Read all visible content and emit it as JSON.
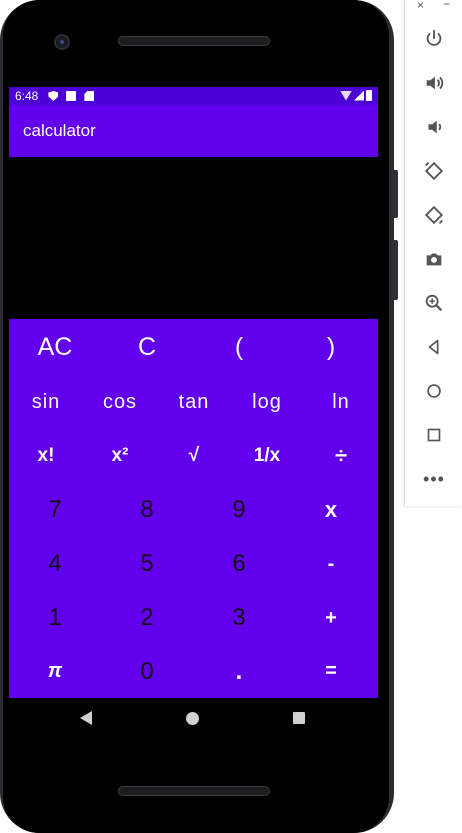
{
  "status_bar": {
    "time": "6:48"
  },
  "app": {
    "title": "calculator"
  },
  "keypad": {
    "row1": [
      "AC",
      "C",
      "(",
      ")"
    ],
    "row2": [
      "sin",
      "cos",
      "tan",
      "log",
      "ln"
    ],
    "row3": [
      "x!",
      "x²",
      "√",
      "1/x",
      "÷"
    ],
    "row4": [
      "7",
      "8",
      "9",
      "x"
    ],
    "row5": [
      "4",
      "5",
      "6",
      "-"
    ],
    "row6": [
      "1",
      "2",
      "3",
      "+"
    ],
    "row7": [
      "π",
      "0",
      ".",
      "="
    ]
  },
  "emulator": {
    "close": "×",
    "minimize": "−",
    "more": "•••",
    "icons": [
      "power-icon",
      "volume-up-icon",
      "volume-down-icon",
      "rotate-left-icon",
      "rotate-right-icon",
      "camera-icon",
      "zoom-icon",
      "back-icon",
      "home-icon",
      "overview-icon",
      "more-icon"
    ]
  },
  "colors": {
    "primary": "#6200ee",
    "primary_dark": "#4b00d6",
    "background": "#000000"
  }
}
